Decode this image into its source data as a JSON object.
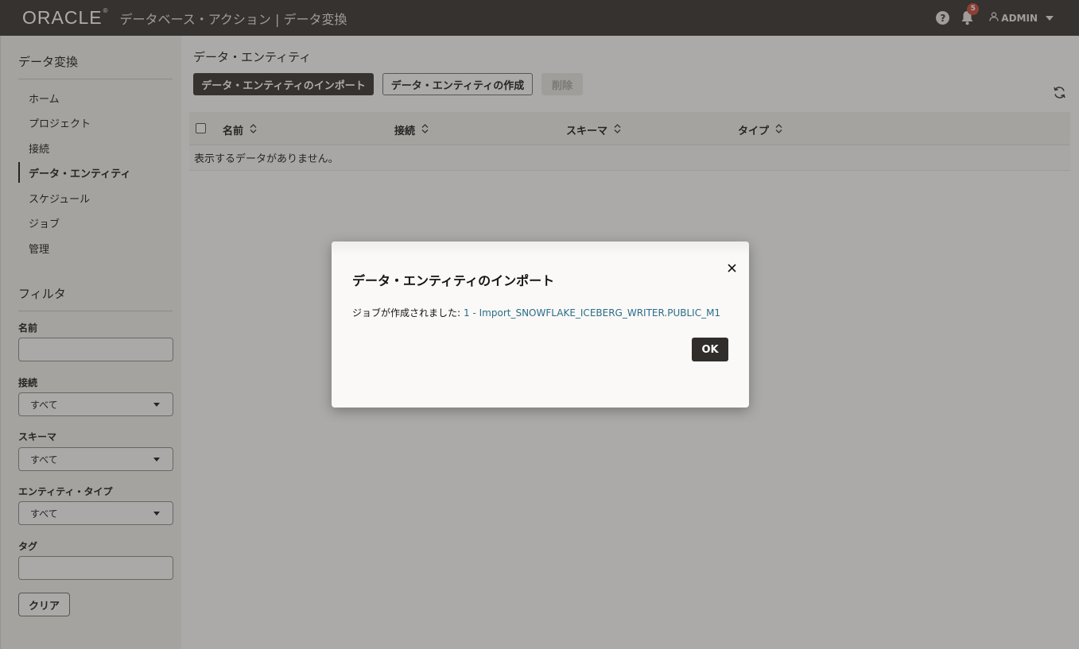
{
  "header": {
    "logo": "ORACLE",
    "title": "データベース・アクション | データ変換",
    "help_icon": "help-icon",
    "notification_count": "5",
    "user": "ADMIN"
  },
  "sidebar": {
    "title": "データ変換",
    "nav": [
      {
        "label": "ホーム"
      },
      {
        "label": "プロジェクト"
      },
      {
        "label": "接続"
      },
      {
        "label": "データ・エンティティ",
        "active": true
      },
      {
        "label": "スケジュール"
      },
      {
        "label": "ジョブ"
      },
      {
        "label": "管理"
      }
    ],
    "filter": {
      "title": "フィルタ",
      "name_label": "名前",
      "name_value": "",
      "connection_label": "接続",
      "connection_value": "すべて",
      "schema_label": "スキーマ",
      "schema_value": "すべて",
      "entity_type_label": "エンティティ・タイプ",
      "entity_type_value": "すべて",
      "tag_label": "タグ",
      "tag_value": "",
      "clear_label": "クリア"
    }
  },
  "main": {
    "title": "データ・エンティティ",
    "import_label": "データ・エンティティのインポート",
    "create_label": "データ・エンティティの作成",
    "delete_label": "削除",
    "columns": [
      "名前",
      "接続",
      "スキーマ",
      "タイプ"
    ],
    "empty_message": "表示するデータがありません。"
  },
  "dialog": {
    "title": "データ・エンティティのインポート",
    "message": "ジョブが作成されました:",
    "job_link": "1 - Import_SNOWFLAKE_ICEBERG_WRITER.PUBLIC_M1",
    "ok_label": "OK"
  },
  "colors": {
    "header_bg": "#312d2a",
    "link": "#2b6d8a",
    "badge": "#c74634"
  }
}
